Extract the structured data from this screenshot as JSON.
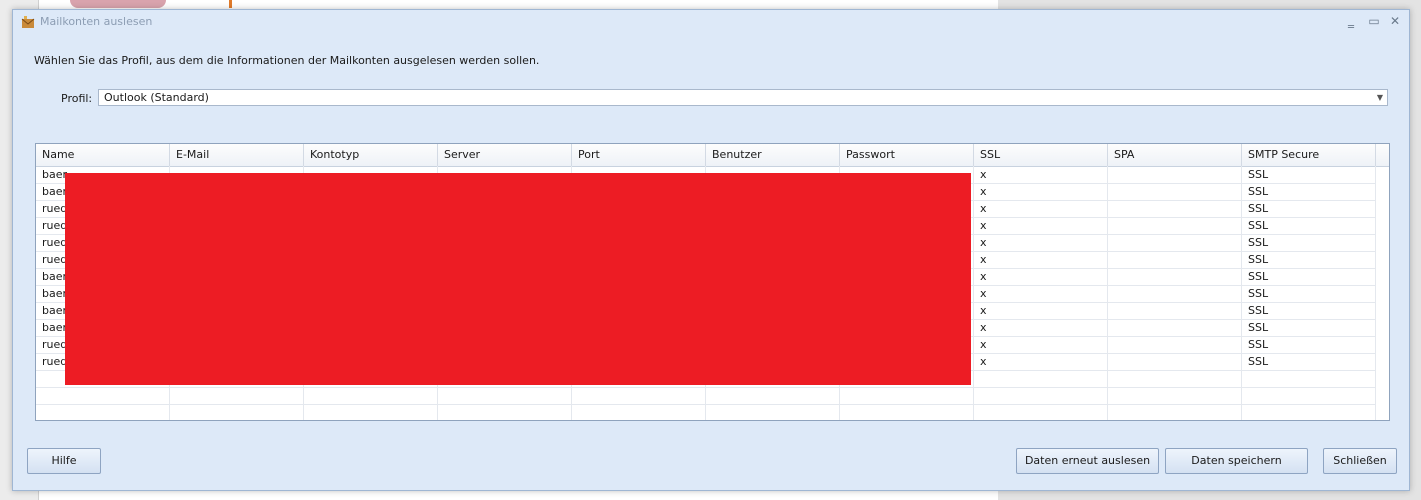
{
  "dialog": {
    "title": "Mailkonten auslesen",
    "instruction": "Wählen Sie das Profil, aus dem die Informationen der Mailkonten ausgelesen werden sollen.",
    "window_buttons": {
      "minimize": "‗",
      "maximize": "▭",
      "close": "✕"
    }
  },
  "profile": {
    "label": "Profil:",
    "value": "Outlook (Standard)"
  },
  "grid": {
    "columns": [
      "Name",
      "E-Mail",
      "Kontotyp",
      "Server",
      "Port",
      "Benutzer",
      "Passwort",
      "SSL",
      "SPA",
      "SMTP Secure"
    ],
    "rows": [
      {
        "name": "baer",
        "ssl": "x",
        "spa": "",
        "smtp": "SSL"
      },
      {
        "name": "baer",
        "ssl": "x",
        "spa": "",
        "smtp": "SSL"
      },
      {
        "name": "rued",
        "ssl": "x",
        "spa": "",
        "smtp": "SSL"
      },
      {
        "name": "rued",
        "ssl": "x",
        "spa": "",
        "smtp": "SSL"
      },
      {
        "name": "rued",
        "ssl": "x",
        "spa": "",
        "smtp": "SSL"
      },
      {
        "name": "rued",
        "ssl": "x",
        "spa": "",
        "smtp": "SSL"
      },
      {
        "name": "baer",
        "ssl": "x",
        "spa": "",
        "smtp": "SSL"
      },
      {
        "name": "baer",
        "ssl": "x",
        "spa": "",
        "smtp": "SSL"
      },
      {
        "name": "baer",
        "ssl": "x",
        "spa": "",
        "smtp": "SSL"
      },
      {
        "name": "baer",
        "ssl": "x",
        "spa": "",
        "smtp": "SSL"
      },
      {
        "name": "rued",
        "ssl": "x",
        "spa": "",
        "smtp": "SSL"
      },
      {
        "name": "rued",
        "ssl": "x",
        "spa": "",
        "smtp": "SSL"
      }
    ],
    "empty_rows": 3,
    "redaction_color": "#ed1c24"
  },
  "buttons": {
    "help": "Hilfe",
    "reread": "Daten erneut auslesen",
    "save": "Daten speichern",
    "close": "Schließen"
  },
  "colors": {
    "dialog_bg": "#dde9f8",
    "border": "#9fb6d3"
  }
}
